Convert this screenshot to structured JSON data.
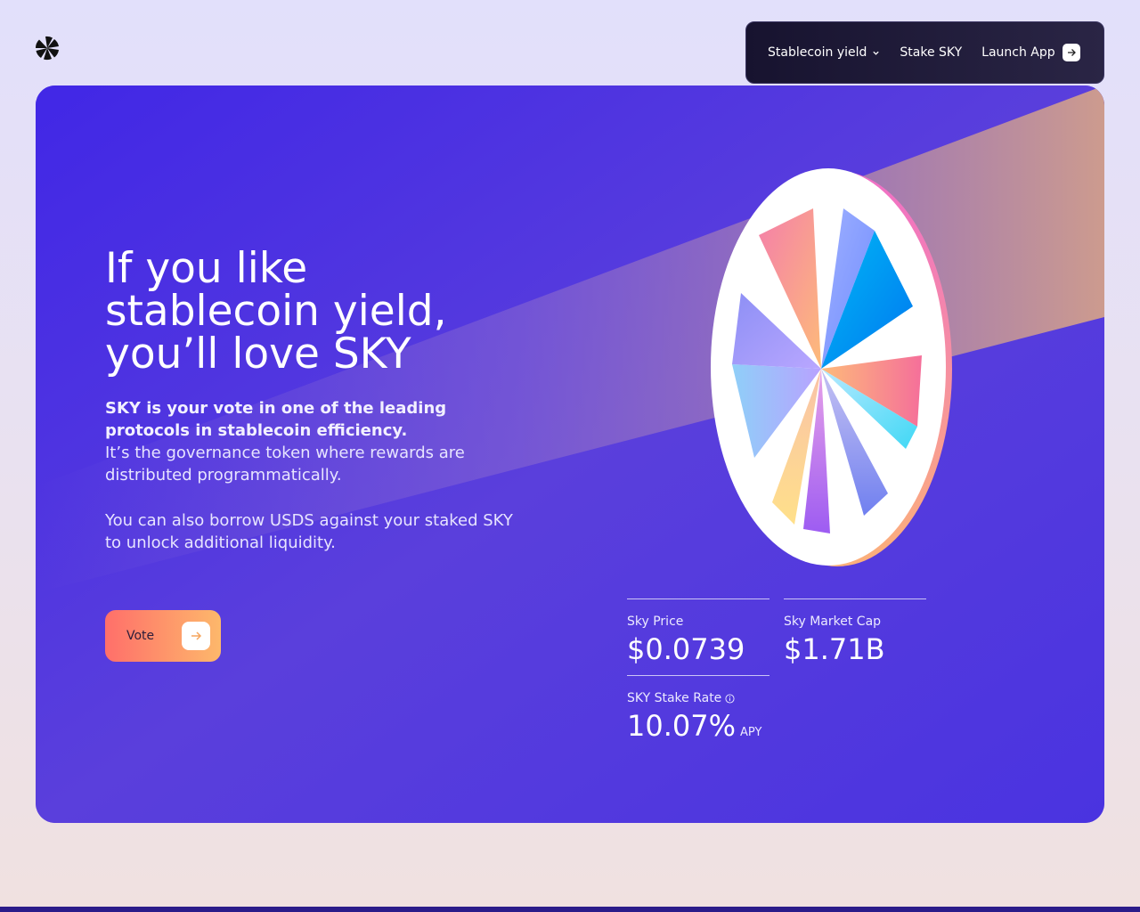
{
  "nav": {
    "items": [
      {
        "label": "Stablecoin yield",
        "icon": "chevron-down-icon"
      },
      {
        "label": "Stake SKY"
      },
      {
        "label": "Launch App",
        "icon": "arrow-right-icon"
      }
    ]
  },
  "hero": {
    "headline": [
      "If you like",
      "stablecoin yield,",
      "you’ll love SKY"
    ],
    "intro_bold": "SKY is your vote in one of the leading protocols in stablecoin efficiency.",
    "intro_text": "It’s the governance token where rewards are distributed programmatically.",
    "paragraph2": "You can also borrow USDS against your staked SKY to unlock additional liquidity.",
    "cta_label": "Vote"
  },
  "stats": {
    "price": {
      "label": "Sky Price",
      "value": "$0.0739"
    },
    "market_cap": {
      "label": "Sky Market Cap",
      "value": "$1.71B"
    },
    "stake_rate": {
      "label": "SKY Stake Rate",
      "value": "10.07%",
      "unit": "APY",
      "icon": "info-icon"
    }
  },
  "colors": {
    "hero_bg": "#4a33e0",
    "nav_bg": "#17132f",
    "cta_start": "#ff6f6a",
    "cta_end": "#fdb86b"
  }
}
